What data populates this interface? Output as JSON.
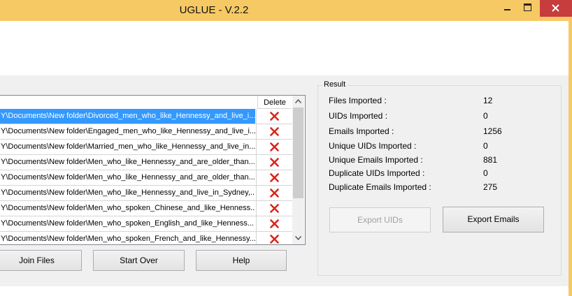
{
  "window": {
    "title": "UGLUE - V.2.2",
    "titlebar_color": "#f6c964",
    "close_color": "#c73c3c"
  },
  "files_grid": {
    "header_delete": "Delete",
    "selection_color": "#3399ff",
    "rows": [
      {
        "path": "Y\\Documents\\New folder\\Divorced_men_who_like_Hennessy_and_live_i...",
        "selected": true
      },
      {
        "path": "Y\\Documents\\New folder\\Engaged_men_who_like_Hennessy_and_live_i...",
        "selected": false
      },
      {
        "path": "Y\\Documents\\New folder\\Married_men_who_like_Hennessy_and_live_in...",
        "selected": false
      },
      {
        "path": "Y\\Documents\\New folder\\Men_who_like_Hennessy_and_are_older_than...",
        "selected": false
      },
      {
        "path": "Y\\Documents\\New folder\\Men_who_like_Hennessy_and_are_older_than...",
        "selected": false
      },
      {
        "path": "Y\\Documents\\New folder\\Men_who_like_Hennessy_and_live_in_Sydney,...",
        "selected": false
      },
      {
        "path": "Y\\Documents\\New folder\\Men_who_spoken_Chinese_and_like_Henness...",
        "selected": false
      },
      {
        "path": "Y\\Documents\\New folder\\Men_who_spoken_English_and_like_Henness...",
        "selected": false
      },
      {
        "path": "Y\\Documents\\New folder\\Men_who_spoken_French_and_like_Hennessy...",
        "selected": false
      }
    ],
    "delete_icon": "red-x-icon"
  },
  "buttons": {
    "join_files": "Join Files",
    "start_over": "Start Over",
    "help": "Help",
    "export_uids": "Export UIDs",
    "export_emails": "Export Emails"
  },
  "result": {
    "legend": "Result",
    "stats": [
      {
        "label": "Files Imported :",
        "value": "12"
      },
      {
        "label": "UIDs Imported :",
        "value": "0"
      },
      {
        "label": "Emails Imported :",
        "value": "1256"
      },
      {
        "label": "Unique UIDs Imported :",
        "value": "0"
      },
      {
        "label": "Unique Emails Imported :",
        "value": "881"
      },
      {
        "label": "Duplicate UIDs Imported :",
        "value": "0"
      },
      {
        "label": "Duplicate Emails Imported :",
        "value": "275"
      }
    ]
  }
}
